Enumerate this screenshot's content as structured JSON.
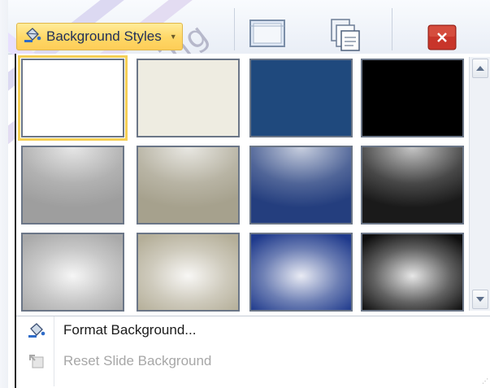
{
  "ribbon": {
    "background_styles_label": "Background Styles",
    "watermark_text": "Learning"
  },
  "gallery": {
    "selected_index": 0,
    "thumbnails": [
      {
        "row": 1,
        "col": 1,
        "fill": "#ffffff",
        "style": "solid"
      },
      {
        "row": 1,
        "col": 2,
        "fill": "#eeece1",
        "style": "solid"
      },
      {
        "row": 1,
        "col": 3,
        "fill": "#1f497d",
        "style": "solid"
      },
      {
        "row": 1,
        "col": 4,
        "fill": "#000000",
        "style": "solid"
      },
      {
        "row": 2,
        "col": 1,
        "fill": "#9e9e9e",
        "style": "top-gradient"
      },
      {
        "row": 2,
        "col": 2,
        "fill": "#a6a18d",
        "style": "top-gradient"
      },
      {
        "row": 2,
        "col": 3,
        "fill": "#243e7e",
        "style": "top-gradient"
      },
      {
        "row": 2,
        "col": 4,
        "fill": "#1a1a1a",
        "style": "top-gradient"
      },
      {
        "row": 3,
        "col": 1,
        "fill": "#a9a9a9",
        "style": "radial"
      },
      {
        "row": 3,
        "col": 2,
        "fill": "#b4ae98",
        "style": "radial"
      },
      {
        "row": 3,
        "col": 3,
        "fill": "#1f3a8c",
        "style": "radial"
      },
      {
        "row": 3,
        "col": 4,
        "fill": "#0e0e0e",
        "style": "radial"
      }
    ]
  },
  "menu": {
    "format_background": "Format Background...",
    "reset_slide_background": "Reset Slide Background"
  },
  "icons": {
    "paint_bucket": "paint-bucket-icon",
    "hide_graphics": "hide-background-graphics-icon",
    "copy_slides": "copy-slides-icon",
    "close": "close-icon",
    "scroll_up": "scroll-up-icon",
    "scroll_down": "scroll-down-icon",
    "reset": "reset-background-icon"
  },
  "colors": {
    "selection_highlight": "#f6cf55",
    "button_highlight": "#ffd766",
    "close_red": "#c8352a"
  }
}
